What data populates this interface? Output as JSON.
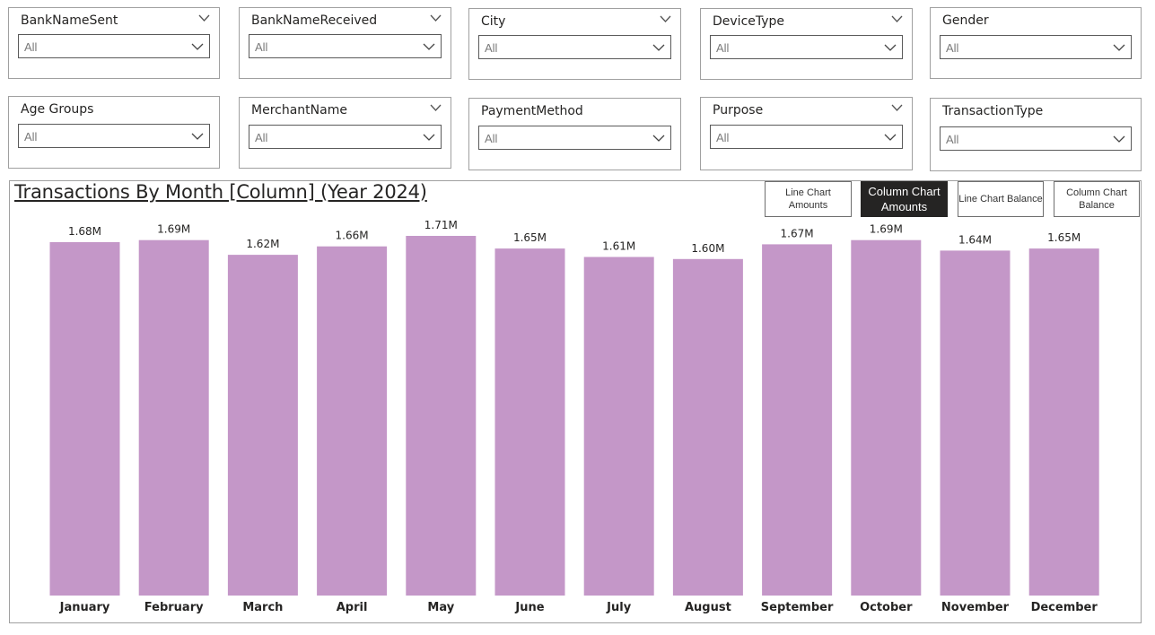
{
  "slicers": [
    {
      "title": "BankNameSent",
      "value": "All"
    },
    {
      "title": "BankNameReceived",
      "value": "All"
    },
    {
      "title": "City",
      "value": "All"
    },
    {
      "title": "DeviceType",
      "value": "All"
    },
    {
      "title": "Gender",
      "value": "All"
    },
    {
      "title": "Age Groups",
      "value": "All"
    },
    {
      "title": "MerchantName",
      "value": "All"
    },
    {
      "title": "PaymentMethod",
      "value": "All"
    },
    {
      "title": "Purpose",
      "value": "All"
    },
    {
      "title": "TransactionType",
      "value": "All"
    }
  ],
  "nav_buttons": [
    {
      "label": "Line Chart Amounts",
      "active": false
    },
    {
      "label": "Column Chart Amounts",
      "active": true
    },
    {
      "label": "Line Chart Balance",
      "active": false
    },
    {
      "label": "Column Chart Balance",
      "active": false
    }
  ],
  "colors": {
    "bar": "#c497c8",
    "active_button": "#252423"
  },
  "chart_data": {
    "type": "bar",
    "title": "Transactions By Month [Column] (Year 2024)",
    "categories": [
      "January",
      "February",
      "March",
      "April",
      "May",
      "June",
      "July",
      "August",
      "September",
      "October",
      "November",
      "December"
    ],
    "values": [
      1.68,
      1.69,
      1.62,
      1.66,
      1.71,
      1.65,
      1.61,
      1.6,
      1.67,
      1.69,
      1.64,
      1.65
    ],
    "data_labels": [
      "1.68M",
      "1.69M",
      "1.62M",
      "1.66M",
      "1.71M",
      "1.65M",
      "1.61M",
      "1.60M",
      "1.67M",
      "1.69M",
      "1.64M",
      "1.65M"
    ],
    "unit": "M",
    "ylim": [
      0,
      1.71
    ],
    "grid": false,
    "legend": false
  }
}
